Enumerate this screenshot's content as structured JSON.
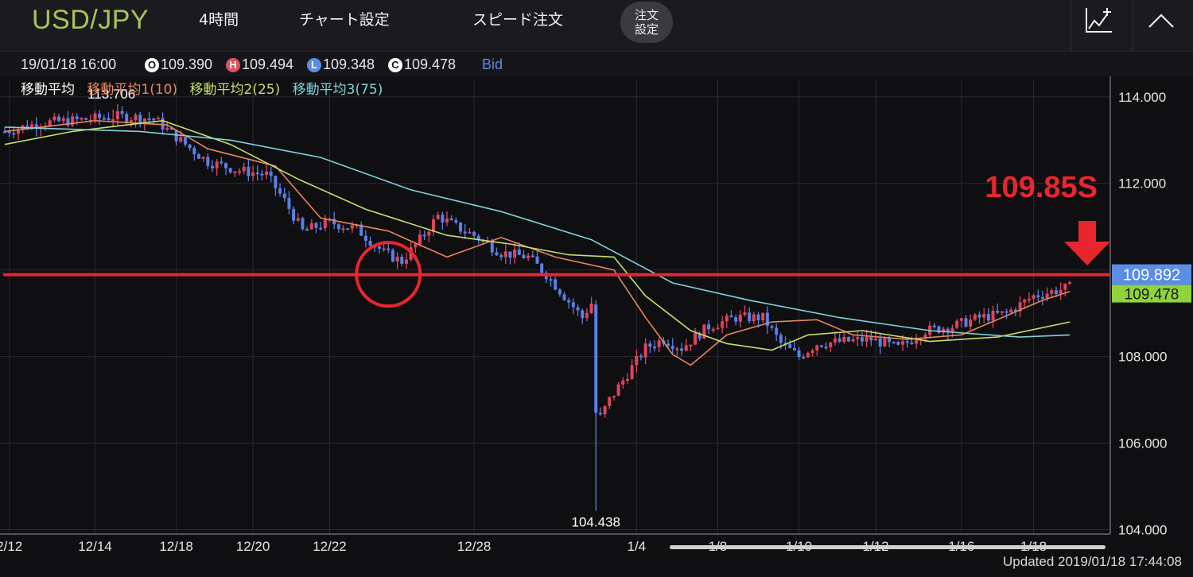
{
  "header": {
    "pair": "USD/JPY",
    "timeframe": "4時間",
    "chart_settings": "チャート設定",
    "speed_order": "スピード注文",
    "order_settings": "注文\n設定"
  },
  "ohlc": {
    "datetime": "19/01/18 16:00",
    "open_badge": "O",
    "open": "109.390",
    "high_badge": "H",
    "high": "109.494",
    "low_badge": "L",
    "low": "109.348",
    "close_badge": "C",
    "close": "109.478",
    "price_type": "Bid"
  },
  "ma_legend": {
    "label": "移動平均",
    "ma1": "移動平均1(10)",
    "ma2": "移動平均2(25)",
    "ma3": "移動平均3(75)"
  },
  "colors": {
    "up": "#e0445c",
    "down": "#5b7fe6",
    "ma1": "#e8865a",
    "ma2": "#c5df6a",
    "ma3": "#7fd3d8",
    "annotation": "#e8262e",
    "current_price_bg": "#5b8de6",
    "close_price_bg": "#8fd43a",
    "grid": "#2a2a30",
    "axis_text": "#e6e6e6"
  },
  "chart_data": {
    "type": "candlestick",
    "ylim": [
      103.9,
      114.4
    ],
    "y_ticks": [
      "114.000",
      "112.000",
      "110.000",
      "108.000",
      "106.000",
      "104.000"
    ],
    "y_tick_values": [
      114,
      112,
      110,
      108,
      106,
      104
    ],
    "x_tick_labels": [
      "2/12",
      "12/14",
      "12/18",
      "12/20",
      "12/22",
      "12/28",
      "1/4",
      "1/8",
      "1/10",
      "1/12",
      "1/16",
      "1/18"
    ],
    "x_tick_index": [
      1,
      20,
      38,
      55,
      72,
      104,
      140,
      158,
      176,
      193,
      212,
      228
    ],
    "high_label": "113.706",
    "low_label": "104.438",
    "series": [
      {
        "name": "移動平均1(10)",
        "key": "ma1",
        "points": [
          [
            0,
            113.2
          ],
          [
            20,
            113.45
          ],
          [
            36,
            113.35
          ],
          [
            45,
            112.8
          ],
          [
            60,
            112.4
          ],
          [
            70,
            111.2
          ],
          [
            85,
            110.9
          ],
          [
            98,
            110.3
          ],
          [
            110,
            110.75
          ],
          [
            122,
            110.3
          ],
          [
            135,
            110.0
          ],
          [
            142,
            108.9
          ],
          [
            148,
            108.05
          ],
          [
            152,
            107.8
          ],
          [
            160,
            108.5
          ],
          [
            170,
            108.8
          ],
          [
            180,
            108.85
          ],
          [
            188,
            108.5
          ],
          [
            200,
            108.4
          ],
          [
            212,
            108.5
          ],
          [
            230,
            109.3
          ],
          [
            236,
            109.5
          ]
        ]
      },
      {
        "name": "移動平均2(25)",
        "key": "ma2",
        "points": [
          [
            0,
            112.9
          ],
          [
            15,
            113.2
          ],
          [
            35,
            113.45
          ],
          [
            50,
            112.9
          ],
          [
            65,
            112.1
          ],
          [
            80,
            111.4
          ],
          [
            98,
            110.8
          ],
          [
            112,
            110.6
          ],
          [
            125,
            110.35
          ],
          [
            135,
            110.3
          ],
          [
            142,
            109.4
          ],
          [
            152,
            108.6
          ],
          [
            160,
            108.3
          ],
          [
            170,
            108.15
          ],
          [
            178,
            108.5
          ],
          [
            190,
            108.6
          ],
          [
            205,
            108.35
          ],
          [
            220,
            108.45
          ],
          [
            236,
            108.8
          ]
        ]
      },
      {
        "name": "移動平均3(75)",
        "key": "ma3",
        "points": [
          [
            0,
            113.3
          ],
          [
            30,
            113.2
          ],
          [
            50,
            113.0
          ],
          [
            70,
            112.6
          ],
          [
            90,
            111.85
          ],
          [
            110,
            111.35
          ],
          [
            130,
            110.7
          ],
          [
            148,
            109.7
          ],
          [
            165,
            109.3
          ],
          [
            185,
            108.9
          ],
          [
            205,
            108.6
          ],
          [
            225,
            108.45
          ],
          [
            236,
            108.5
          ]
        ]
      }
    ],
    "candle_anchors": [
      [
        0,
        113.2
      ],
      [
        8,
        113.4
      ],
      [
        15,
        113.45
      ],
      [
        25,
        113.55
      ],
      [
        33,
        113.5
      ],
      [
        40,
        112.9
      ],
      [
        45,
        112.5
      ],
      [
        52,
        112.3
      ],
      [
        58,
        112.2
      ],
      [
        62,
        111.6
      ],
      [
        66,
        110.9
      ],
      [
        72,
        111.1
      ],
      [
        78,
        110.95
      ],
      [
        84,
        110.4
      ],
      [
        88,
        110.2
      ],
      [
        92,
        110.7
      ],
      [
        96,
        111.25
      ],
      [
        100,
        111.0
      ],
      [
        104,
        110.8
      ],
      [
        110,
        110.4
      ],
      [
        116,
        110.3
      ],
      [
        120,
        109.9
      ],
      [
        124,
        109.4
      ],
      [
        128,
        108.9
      ],
      [
        131,
        109.4
      ],
      [
        132,
        106.6
      ],
      [
        134,
        107.0
      ],
      [
        138,
        107.6
      ],
      [
        142,
        108.2
      ],
      [
        146,
        108.4
      ],
      [
        150,
        108.2
      ],
      [
        156,
        108.7
      ],
      [
        162,
        108.9
      ],
      [
        168,
        108.9
      ],
      [
        172,
        108.3
      ],
      [
        176,
        108.0
      ],
      [
        180,
        108.3
      ],
      [
        186,
        108.35
      ],
      [
        192,
        108.4
      ],
      [
        198,
        108.2
      ],
      [
        204,
        108.6
      ],
      [
        210,
        108.7
      ],
      [
        216,
        108.9
      ],
      [
        222,
        109.0
      ],
      [
        228,
        109.4
      ],
      [
        236,
        109.6
      ]
    ],
    "spike_low_index": 131,
    "spike_low": 104.438,
    "spike_high_index": 24,
    "spike_high": 113.706,
    "horizontal_line": 109.892,
    "current_price_label": "109.892",
    "close_price_label": "109.478",
    "annotation_text": "109.85S",
    "circle_center": [
      85,
      109.9
    ]
  },
  "footer": {
    "updated": "Updated  2019/01/18 17:44:08"
  }
}
